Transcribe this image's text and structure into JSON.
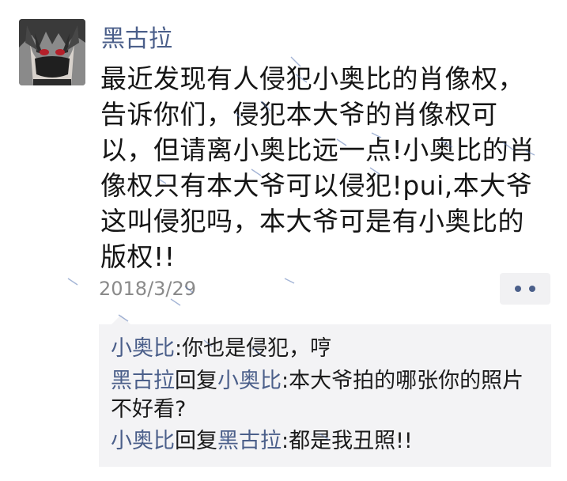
{
  "post": {
    "username": "黑古拉",
    "text": "最近发现有人侵犯小奥比的肖像权，\n告诉你们，侵犯本大爷的肖像权可\n以，但请离小奥比远一点!小奥比的肖\n像权只有本大爷可以侵犯!pui,本大爷\n这叫侵犯吗，本大爷可是有小奥比的\n版权!!",
    "timestamp": "2018/3/29",
    "more_icon": "more-dots-icon"
  },
  "comments": [
    {
      "author": "小奥比",
      "separator": ":",
      "text": "你也是侵犯，哼"
    },
    {
      "author": "黑古拉",
      "reply_word": "回复",
      "reply_to": "小奥比",
      "separator": ":",
      "text": "本大爷拍的哪张你的照片不好看?"
    },
    {
      "author": "小奥比",
      "reply_word": "回复",
      "reply_to": "黑古拉",
      "separator": ":",
      "text": "都是我丑照!!"
    }
  ],
  "colors": {
    "link": "#4b5f8a",
    "text": "#151515",
    "timestamp": "#8a8a8a",
    "comments_bg": "#f3f3f5",
    "page_bg": "#ffffff"
  }
}
